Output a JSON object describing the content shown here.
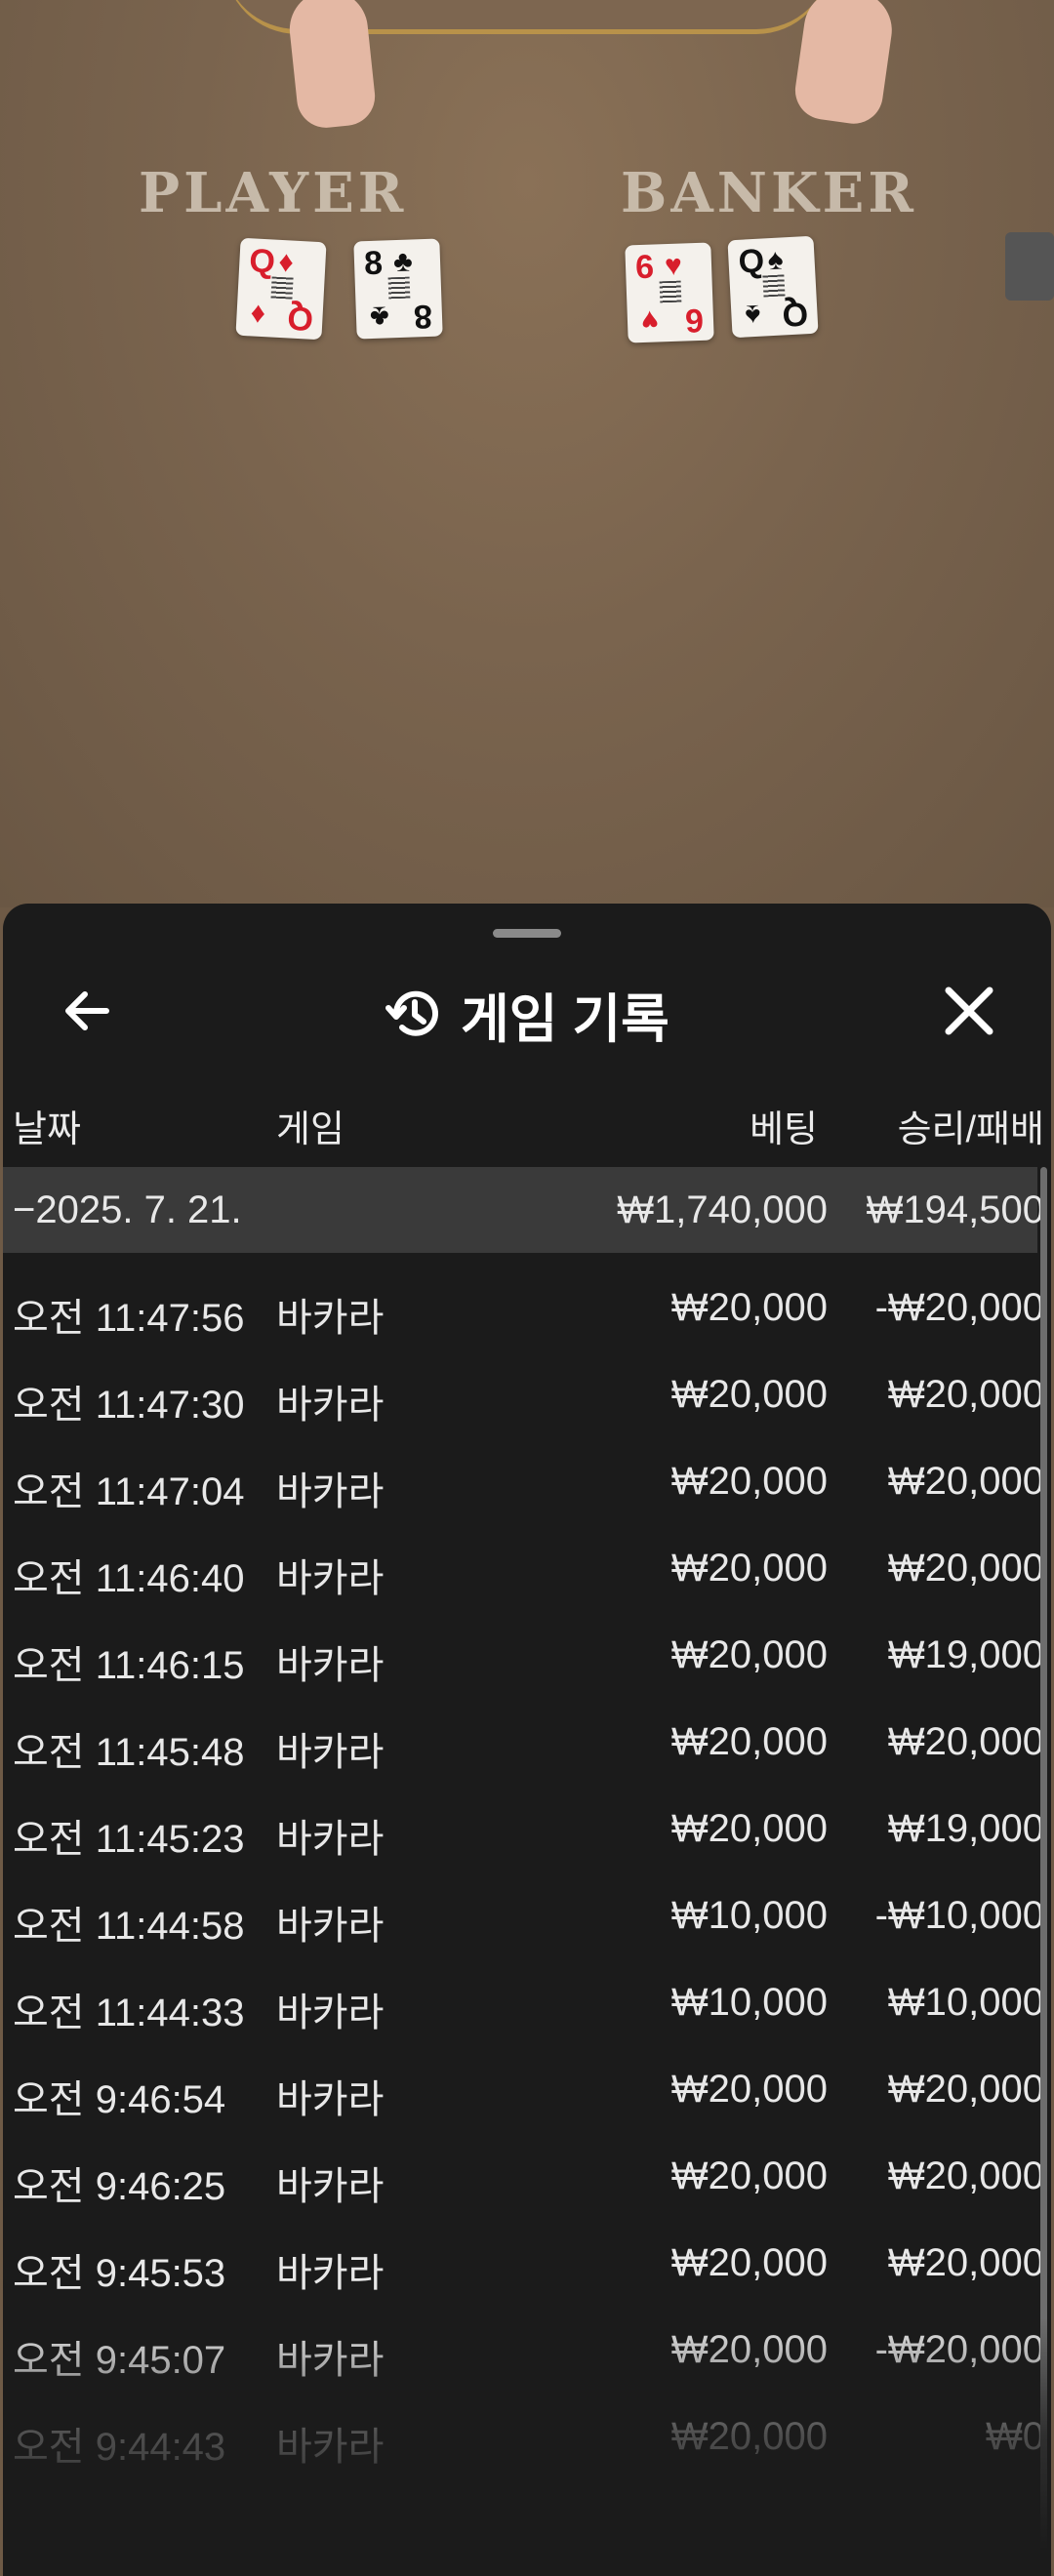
{
  "table": {
    "player_label": "PLAYER",
    "banker_label": "BANKER",
    "player_cards": [
      {
        "rank": "Q",
        "suit": "♦",
        "color": "red"
      },
      {
        "rank": "8",
        "suit": "♣",
        "color": "black"
      }
    ],
    "banker_cards": [
      {
        "rank": "6",
        "suit": "♥",
        "color": "red"
      },
      {
        "rank": "Q",
        "suit": "♠",
        "color": "black"
      }
    ]
  },
  "sheet": {
    "title": "게임 기록",
    "icons": {
      "back": "arrow-left-icon",
      "history": "history-clock-icon",
      "close": "close-x-icon"
    },
    "columns": {
      "date": "날짜",
      "game": "게임",
      "bet": "베팅",
      "winloss": "승리/패배"
    },
    "date_group": {
      "date": "−2025. 7. 21.",
      "bet_total": "₩1,740,000",
      "winloss_total": "₩194,500"
    },
    "rows": [
      {
        "time": "오전 11:47:56",
        "game": "바카라",
        "bet": "₩20,000",
        "result": "-₩20,000"
      },
      {
        "time": "오전 11:47:30",
        "game": "바카라",
        "bet": "₩20,000",
        "result": "₩20,000"
      },
      {
        "time": "오전 11:47:04",
        "game": "바카라",
        "bet": "₩20,000",
        "result": "₩20,000"
      },
      {
        "time": "오전 11:46:40",
        "game": "바카라",
        "bet": "₩20,000",
        "result": "₩20,000"
      },
      {
        "time": "오전 11:46:15",
        "game": "바카라",
        "bet": "₩20,000",
        "result": "₩19,000"
      },
      {
        "time": "오전 11:45:48",
        "game": "바카라",
        "bet": "₩20,000",
        "result": "₩20,000"
      },
      {
        "time": "오전 11:45:23",
        "game": "바카라",
        "bet": "₩20,000",
        "result": "₩19,000"
      },
      {
        "time": "오전 11:44:58",
        "game": "바카라",
        "bet": "₩10,000",
        "result": "-₩10,000"
      },
      {
        "time": "오전 11:44:33",
        "game": "바카라",
        "bet": "₩10,000",
        "result": "₩10,000"
      },
      {
        "time": "오전 9:46:54",
        "game": "바카라",
        "bet": "₩20,000",
        "result": "₩20,000"
      },
      {
        "time": "오전 9:46:25",
        "game": "바카라",
        "bet": "₩20,000",
        "result": "₩20,000"
      },
      {
        "time": "오전 9:45:53",
        "game": "바카라",
        "bet": "₩20,000",
        "result": "₩20,000"
      },
      {
        "time": "오전 9:45:07",
        "game": "바카라",
        "bet": "₩20,000",
        "result": "-₩20,000"
      },
      {
        "time": "오전 9:44:43",
        "game": "바카라",
        "bet": "₩20,000",
        "result": "₩0"
      }
    ]
  }
}
